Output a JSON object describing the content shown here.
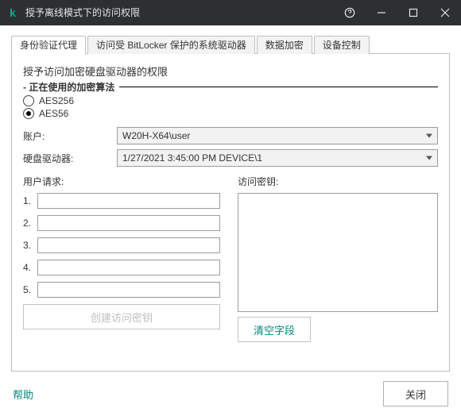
{
  "titlebar": {
    "title": "授予离线模式下的访问权限"
  },
  "tabs": [
    "身份验证代理",
    "访问受 BitLocker 保护的系统驱动器",
    "数据加密",
    "设备控制"
  ],
  "heading": "授予访问加密硬盘驱动器的权限",
  "group_label": "- 正在使用的加密算法",
  "algorithms": {
    "opt1": "AES256",
    "opt2": "AES56",
    "selected": 1
  },
  "form": {
    "account_label": "账户:",
    "account_value": "W20H-X64\\user",
    "drive_label": "硬盘驱动器:",
    "drive_value": "1/27/2021 3:45:00 PM  DEVICE\\1"
  },
  "requests": {
    "label": "用户请求:",
    "rows": [
      "1.",
      "2.",
      "3.",
      "4.",
      "5."
    ],
    "values": [
      "",
      "",
      "",
      "",
      ""
    ]
  },
  "key": {
    "label": "访问密钥:",
    "value": ""
  },
  "buttons": {
    "create": "创建访问密钥",
    "clear": "清空字段"
  },
  "footer": {
    "help": "帮助",
    "close": "关闭"
  }
}
